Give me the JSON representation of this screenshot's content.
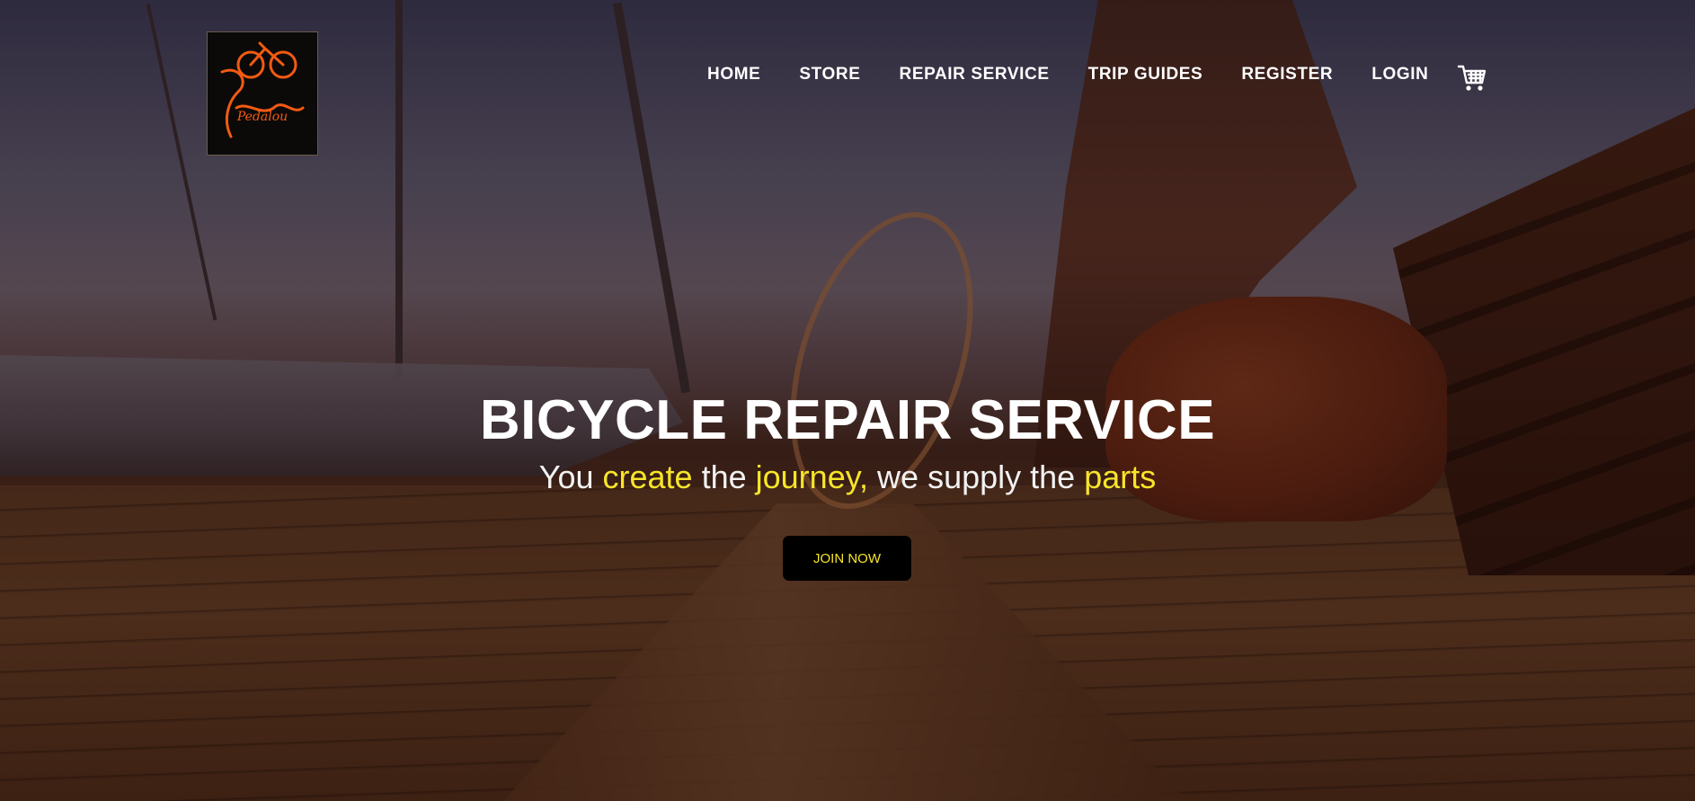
{
  "brand": {
    "logo_text": "Pedalou",
    "logo_color": "#f25a12"
  },
  "nav": {
    "items": [
      {
        "label": "HOME"
      },
      {
        "label": "STORE"
      },
      {
        "label": "REPAIR SERVICE"
      },
      {
        "label": "TRIP GUIDES"
      },
      {
        "label": "REGISTER"
      },
      {
        "label": "LOGIN"
      }
    ],
    "cart_icon": "shopping-cart-icon"
  },
  "hero": {
    "title": "BICYCLE REPAIR SERVICE",
    "tagline": {
      "w1": "You ",
      "w2": "create",
      "w3": " the ",
      "w4": "journey,",
      "w5": " we supply the ",
      "w6": "parts"
    },
    "cta_label": "JOIN NOW",
    "accent_color": "#f7e52a"
  }
}
